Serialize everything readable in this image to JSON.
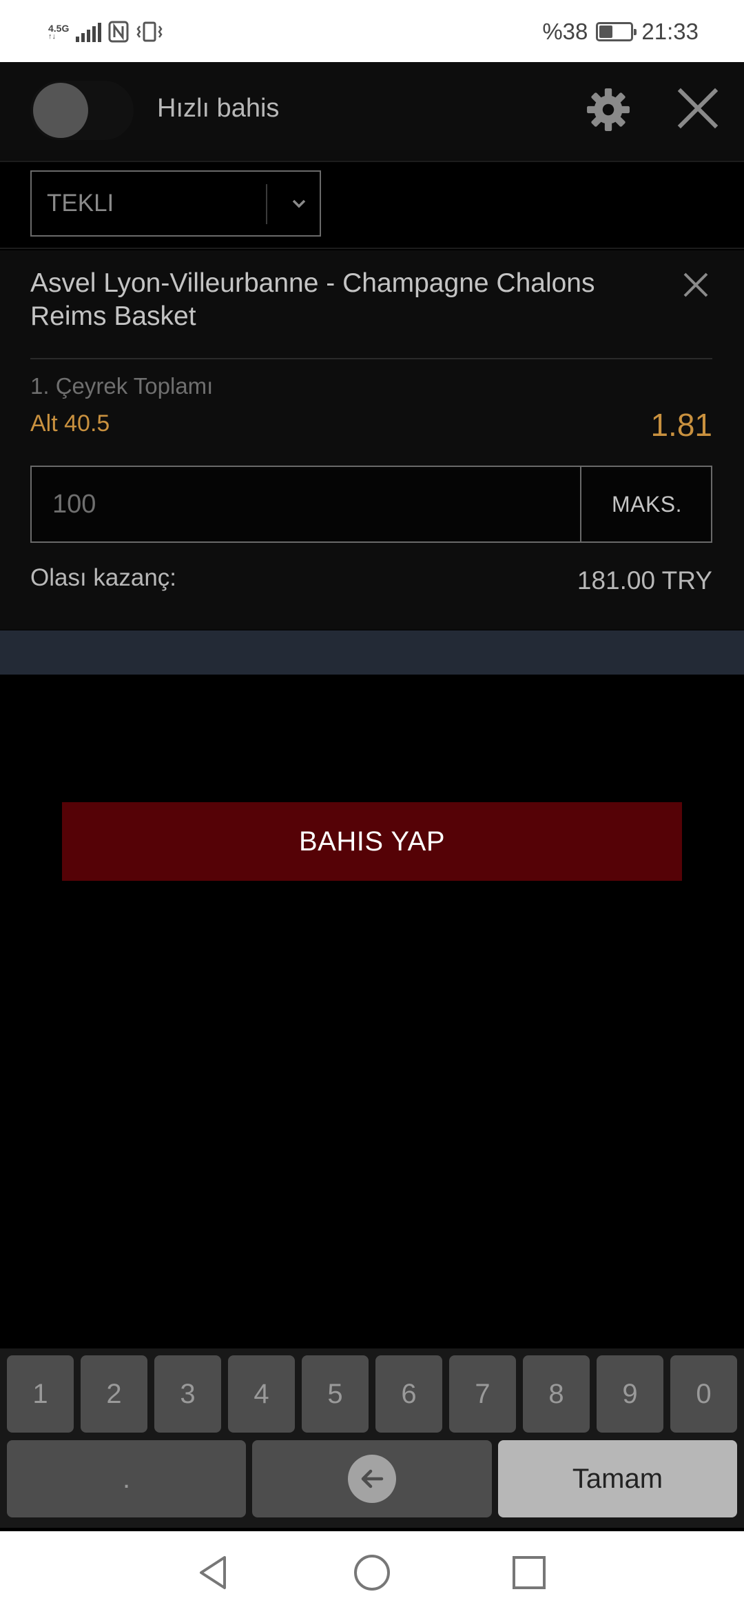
{
  "status_bar": {
    "network_label_top": "4.5G",
    "network_label_bottom": "↑↓",
    "battery_percent_text": "%38",
    "battery_level": 0.38,
    "time": "21:33",
    "icons": [
      "signal-icon",
      "nfc-icon",
      "vibrate-icon",
      "battery-icon"
    ]
  },
  "header": {
    "quick_bet_label": "Hızlı bahis",
    "quick_bet_enabled": false,
    "settings_icon": "gear-icon",
    "close_icon": "close-icon"
  },
  "bet_type": {
    "selected": "TEKLI",
    "icon": "chevron-down-icon"
  },
  "bet": {
    "match": "Asvel Lyon-Villeurbanne - Champagne Chalons Reims Basket",
    "market": "1. Çeyrek Toplamı",
    "selection": "Alt 40.5",
    "odds": "1.81",
    "stake_placeholder": "100",
    "max_label": "MAKS.",
    "potential_win_label": "Olası kazanç:",
    "potential_win_value": "181.00 TRY",
    "remove_icon": "close-icon"
  },
  "actions": {
    "place_bet_label": "BAHIS YAP"
  },
  "keyboard": {
    "digits": [
      "1",
      "2",
      "3",
      "4",
      "5",
      "6",
      "7",
      "8",
      "9",
      "0"
    ],
    "decimal": ".",
    "backspace_icon": "backspace-arrow-icon",
    "done_label": "Tamam"
  },
  "nav_bar": {
    "icons": [
      "back-triangle-icon",
      "home-circle-icon",
      "recents-square-icon"
    ]
  },
  "colors": {
    "accent_gold": "#c9913f",
    "place_bet_bg": "#550206",
    "stripe": "#232a36"
  }
}
